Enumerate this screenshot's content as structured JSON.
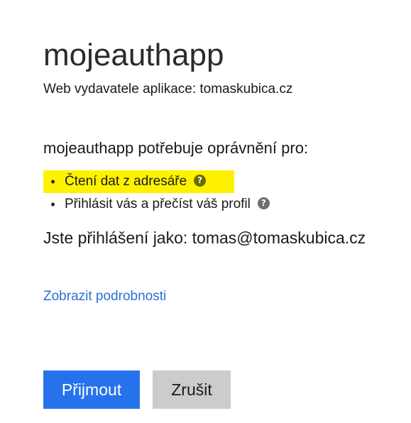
{
  "app": {
    "name": "mojeauthapp",
    "publisher": "Web vydavatele aplikace: tomaskubica.cz"
  },
  "consent": {
    "heading": "mojeauthapp potřebuje oprávnění pro:",
    "permissions": [
      {
        "bullet": "•",
        "label": "Čtení dat z adresáře",
        "help_icon": "question-circle-icon",
        "help_glyph": "?",
        "highlighted": true
      },
      {
        "bullet": "•",
        "label": "Přihlásit vás a přečíst váš profil",
        "help_icon": "question-circle-icon",
        "help_glyph": "?",
        "highlighted": false
      }
    ],
    "signed_in_as": "Jste přihlášení jako: tomas@tomaskubica.cz",
    "details_link": "Zobrazit podrobnosti"
  },
  "actions": {
    "accept_label": "Přijmout",
    "cancel_label": "Zrušit"
  },
  "colors": {
    "accent": "#2672ec",
    "link": "#2b6fd6",
    "highlight": "#fff200",
    "cancel_bg": "#cccccc"
  }
}
